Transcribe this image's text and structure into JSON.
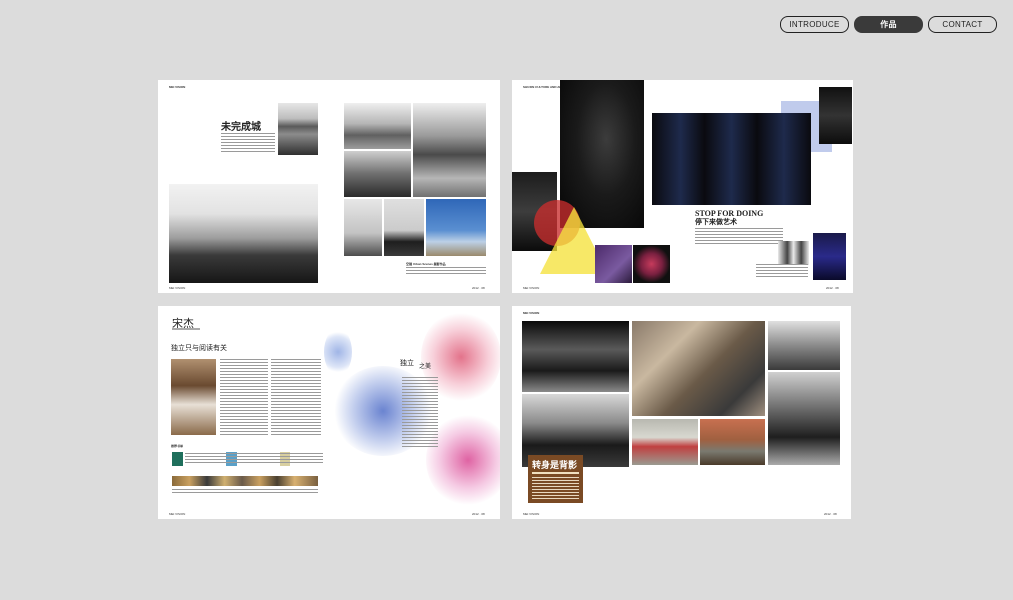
{
  "nav": {
    "introduce": "INTRODUCE",
    "works": "作品",
    "contact": "CONTACT"
  },
  "spread1": {
    "header": "MEI VISION",
    "title": "未完成城",
    "caption": "空镜 Urban Scenes 摄影作品",
    "folio_left": "MEI VISION",
    "folio_right": "2012 · 08"
  },
  "spread2": {
    "header": "SHUXIN CULTURE AND ART",
    "title_en": "STOP FOR DOING",
    "title_cn": "停下来做艺术",
    "folio_left": "MEI VISION",
    "folio_right": "2012 · 08"
  },
  "spread3": {
    "name": "宋杰",
    "subtitle": "独立只与阅读有关",
    "quote": "独立",
    "quote2": "之美",
    "section": "推荐书单",
    "folio_left": "MEI VISION",
    "folio_right": "2012 · 08"
  },
  "spread4": {
    "header": "MEI VISION",
    "title": "转身是背影",
    "folio_left": "MEI VISION",
    "folio_right": "2012 · 08"
  },
  "colors": {
    "background": "#dcdcdc",
    "nav_active": "#3a3a3a",
    "accent_brown": "#7a4a24"
  }
}
